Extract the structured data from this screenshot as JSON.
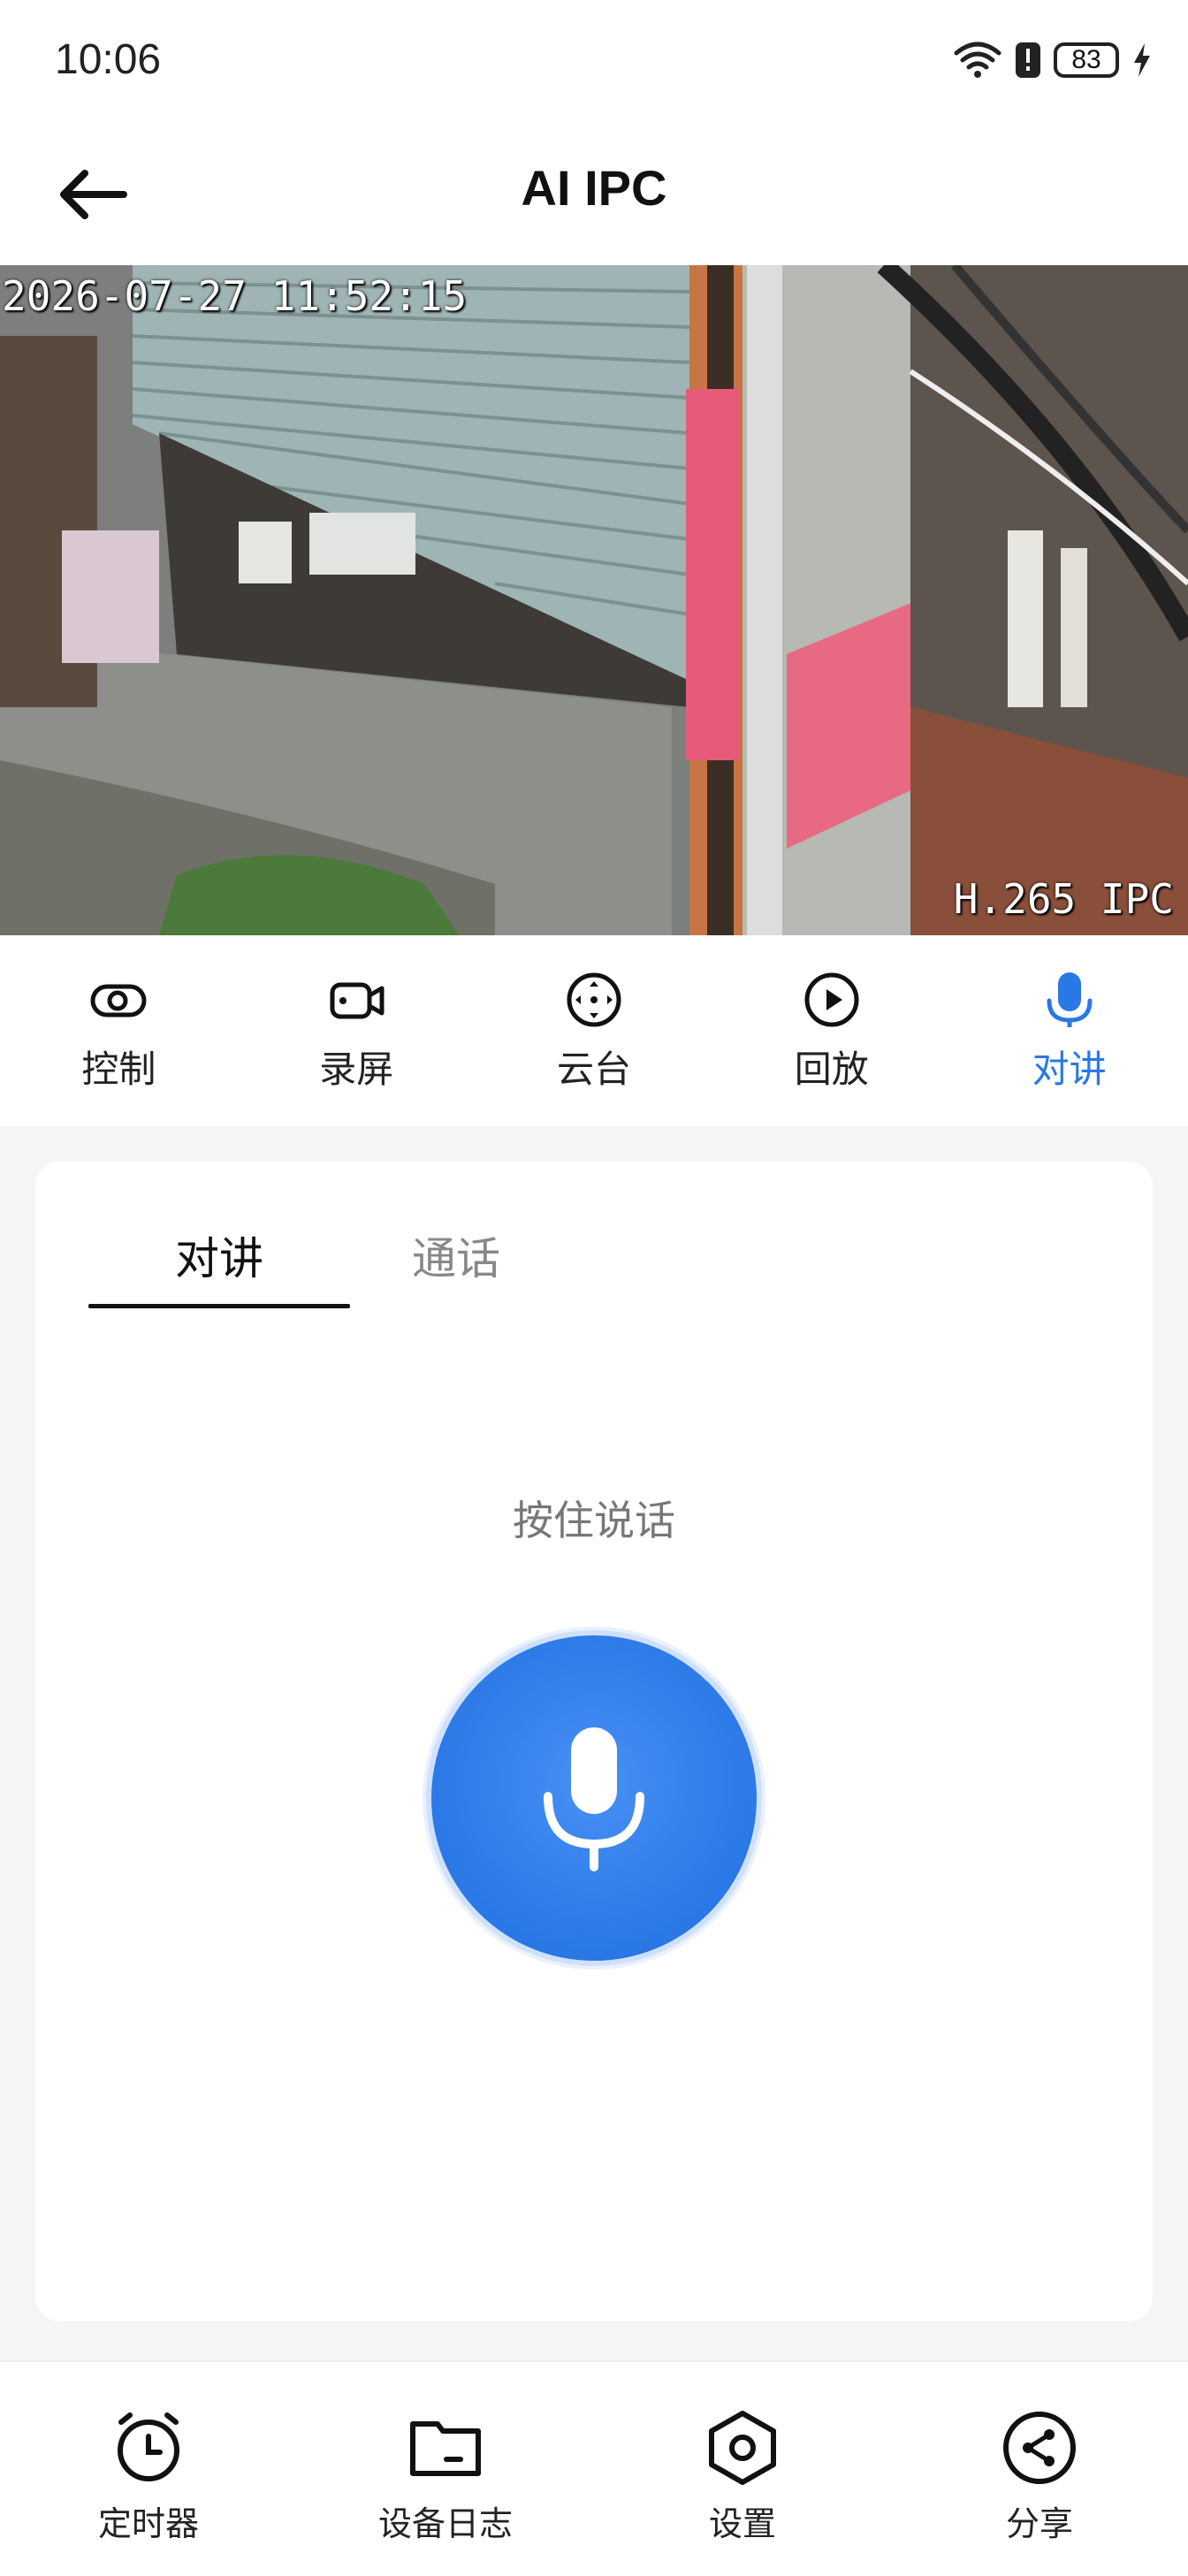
{
  "status_bar": {
    "time": "10:06",
    "battery": "83"
  },
  "header": {
    "title": "AI IPC"
  },
  "video": {
    "timestamp": "2026-07-27 11:52:15",
    "codec": "H.265 IPC"
  },
  "toolbar": {
    "items": [
      {
        "label": "控制",
        "icon": "toggle-icon"
      },
      {
        "label": "录屏",
        "icon": "video-camera-icon"
      },
      {
        "label": "云台",
        "icon": "ptz-icon"
      },
      {
        "label": "回放",
        "icon": "play-icon"
      },
      {
        "label": "对讲",
        "icon": "mic-icon",
        "active": true
      }
    ],
    "active_color": "#2a78e6"
  },
  "talk_panel": {
    "tabs": [
      {
        "label": "对讲",
        "active": true
      },
      {
        "label": "通话"
      }
    ],
    "hint": "按住说话"
  },
  "bottom_nav": {
    "items": [
      {
        "label": "定时器",
        "icon": "alarm-clock-icon"
      },
      {
        "label": "设备日志",
        "icon": "folder-icon"
      },
      {
        "label": "设置",
        "icon": "settings-hex-icon"
      },
      {
        "label": "分享",
        "icon": "share-icon"
      }
    ]
  }
}
